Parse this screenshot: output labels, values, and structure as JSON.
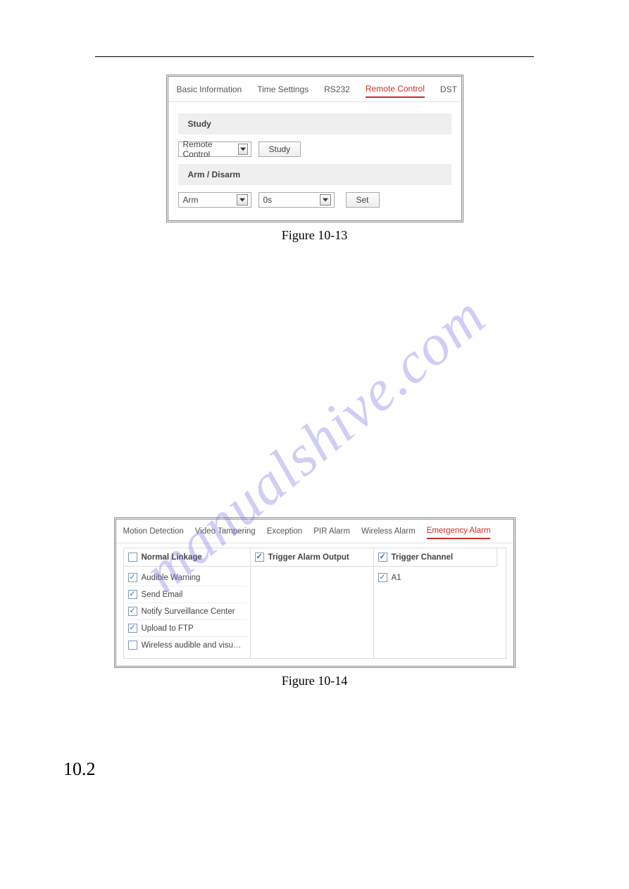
{
  "watermark": "manualshive.com",
  "panel1": {
    "tabs": [
      "Basic Information",
      "Time Settings",
      "RS232",
      "Remote Control",
      "DST"
    ],
    "active_tab": "Remote Control",
    "study_section": "Study",
    "study_select": "Remote Control",
    "study_button": "Study",
    "arm_section": "Arm / Disarm",
    "arm_select": "Arm",
    "delay_select": "0s",
    "set_button": "Set"
  },
  "fig1_caption": "Figure 10-13",
  "panel2": {
    "tabs": [
      "Motion Detection",
      "Video Tampering",
      "Exception",
      "PIR Alarm",
      "Wireless Alarm",
      "Emergency Alarm"
    ],
    "active_tab": "Emergency Alarm",
    "columns": [
      {
        "header": "Normal Linkage",
        "header_checked": false,
        "items": [
          {
            "label": "Audible Warning",
            "checked": true
          },
          {
            "label": "Send Email",
            "checked": true
          },
          {
            "label": "Notify Surveillance Center",
            "checked": true
          },
          {
            "label": "Upload to FTP",
            "checked": true
          },
          {
            "label": "Wireless audible and visual…",
            "checked": false
          }
        ]
      },
      {
        "header": "Trigger Alarm Output",
        "header_checked": true,
        "items": []
      },
      {
        "header": "Trigger Channel",
        "header_checked": true,
        "items": [
          {
            "label": "A1",
            "checked": true
          }
        ]
      }
    ]
  },
  "fig2_caption": "Figure 10-14",
  "section_number": "10.2"
}
